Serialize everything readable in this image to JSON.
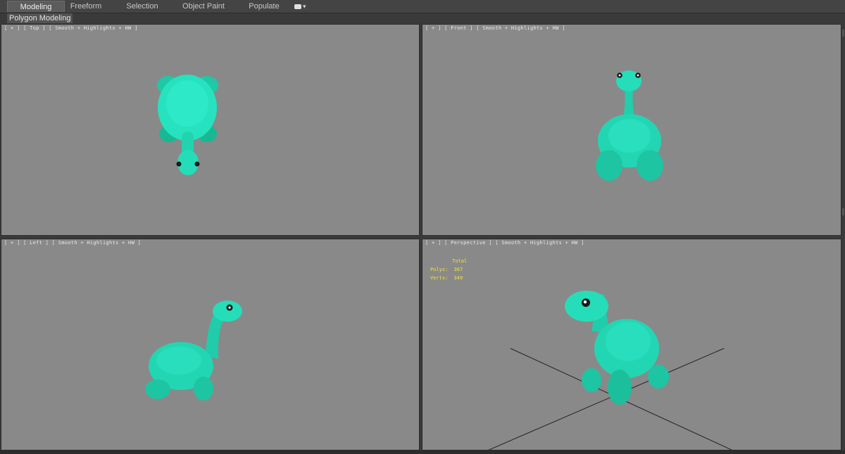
{
  "ribbon": {
    "tabs": [
      {
        "label": "Modeling",
        "active": true
      },
      {
        "label": "Freeform",
        "active": false
      },
      {
        "label": "Selection",
        "active": false
      },
      {
        "label": "Object Paint",
        "active": false
      },
      {
        "label": "Populate",
        "active": false
      }
    ],
    "extra_icon": "toggle-icon"
  },
  "subbar": {
    "label": "Polygon Modeling"
  },
  "viewports": {
    "top": {
      "label": "[ + ] [ Top ] [ Smooth + Highlights + HW ]"
    },
    "front": {
      "label": "[ + ] [ Front ] [ Smooth + Highlights + HW ]"
    },
    "left": {
      "label": "[ + ] [ Left ] [ Smooth + Highlights + HW ]"
    },
    "perspective": {
      "label": "[ + ] [ Perspective ] [ Smooth + Highlights + HW ]",
      "stats": {
        "header": "Total",
        "polys_label": "Polys:",
        "polys_value": "367",
        "verts_label": "Verts:",
        "verts_value": "349"
      }
    }
  },
  "colors": {
    "model": "#26dcb8",
    "model_shade": "#15b48f",
    "viewport_bg": "#898989",
    "stats_text": "#f2e23a"
  }
}
